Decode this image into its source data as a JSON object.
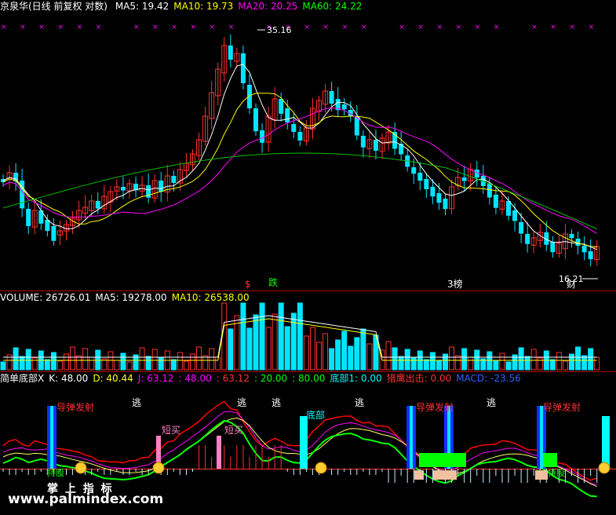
{
  "price_panel": {
    "title": "京泉华(日线 前复权 对数)",
    "ma_labels": [
      {
        "text": "MA5: 19.42",
        "color": "#ffffff"
      },
      {
        "text": "MA10: 19.73",
        "color": "#ffff00"
      },
      {
        "text": "MA20: 20.25",
        "color": "#ff00ff"
      },
      {
        "text": "MA60: 24.22",
        "color": "#00ff00"
      }
    ],
    "high_label": "35.16",
    "low_label": "16.21",
    "signal_labels": [
      {
        "text": "跌",
        "color": "#00ff00"
      },
      {
        "text": "$",
        "color": "#ff3030"
      },
      {
        "text": "3榜",
        "color": "#ffffff"
      },
      {
        "text": "财",
        "color": "#ffffff"
      }
    ]
  },
  "volume_panel": {
    "labels": [
      {
        "text": "VOLUME: 26726.01",
        "color": "#ffffff"
      },
      {
        "text": "MA5: 19278.00",
        "color": "#ffffff"
      },
      {
        "text": "MA10: 26538.00",
        "color": "#ffff00"
      }
    ]
  },
  "indicator_panel": {
    "labels": [
      {
        "text": "简单底部X",
        "color": "#ffffff"
      },
      {
        "text": "K: 48.00",
        "color": "#ffffff"
      },
      {
        "text": "D: 40.44",
        "color": "#ffff00"
      },
      {
        "text": "J: 63.12",
        "color": "#ff00ff"
      },
      {
        "text": ": 48.00",
        "color": "#ff00ff"
      },
      {
        "text": ": 63.12",
        "color": "#ff3030"
      },
      {
        "text": ": 20.00",
        "color": "#00ff00"
      },
      {
        "text": ": 80.00",
        "color": "#00ff00"
      },
      {
        "text": "底部1: 0.00",
        "color": "#00ffff"
      },
      {
        "text": "猎鹰出击: 0.00",
        "color": "#ff3030"
      },
      {
        "text": "MACD: -23.56",
        "color": "#3060ff"
      }
    ],
    "annotations": {
      "missile": "导弹发射",
      "escape": "逃",
      "short_buy": "短买",
      "bottom": "底部",
      "hold": "持股",
      "buy_point": "买点"
    }
  },
  "watermark": {
    "line1": "掌 上 指 标",
    "line2": "www.palmindex.com"
  },
  "chart_data": {
    "type": "candlestick",
    "title": "京泉华(日线 前复权 对数)",
    "moving_averages": {
      "MA5": 19.42,
      "MA10": 19.73,
      "MA20": 20.25,
      "MA60": 24.22
    },
    "marked_high": 35.16,
    "marked_low": 16.21,
    "volume": {
      "VOLUME": 26726.01,
      "MA5": 19278.0,
      "MA10": 26538.0
    },
    "indicator": {
      "K": 48.0,
      "D": 40.44,
      "J": 63.12,
      "底部1": 0.0,
      "猎鹰出击": 0.0,
      "MACD": -23.56
    }
  }
}
